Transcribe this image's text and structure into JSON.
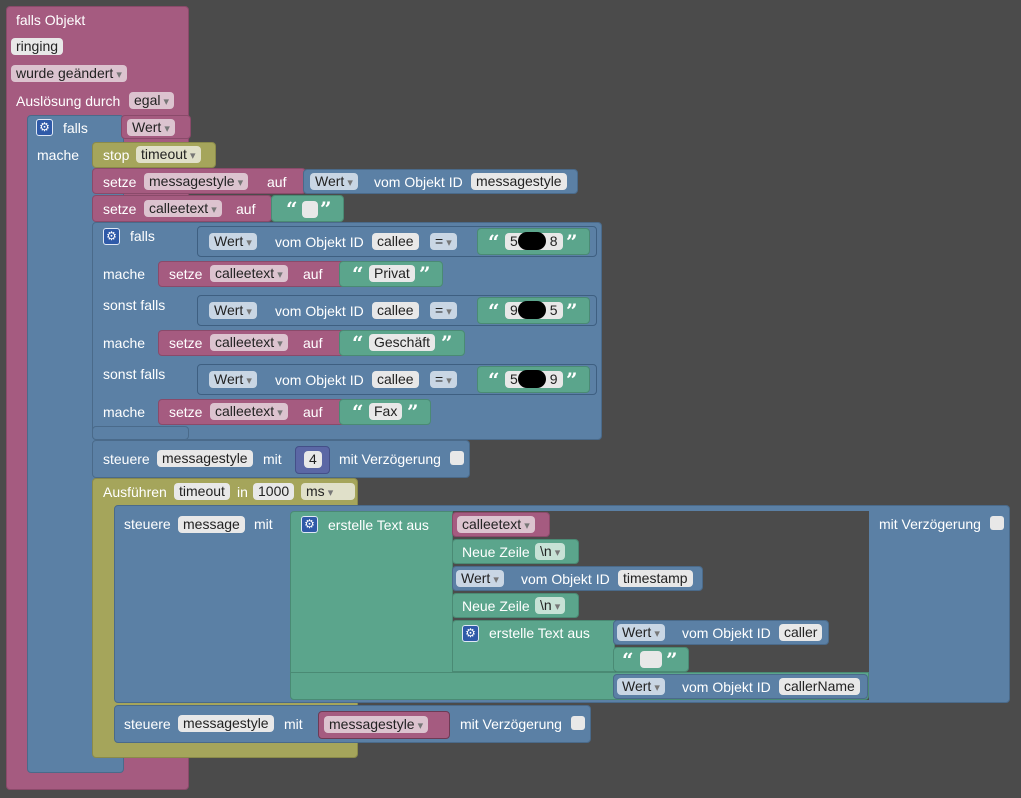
{
  "trigger": {
    "title": "falls Objekt",
    "object_id": "ringing",
    "condition": "wurde geändert",
    "trigger_label": "Auslösung durch",
    "trigger_value": "egal"
  },
  "if1": {
    "falls": "falls",
    "mache": "mache",
    "condition": "Wert"
  },
  "stop": {
    "label": "stop",
    "timer": "timeout"
  },
  "set1": {
    "setze": "setze",
    "var": "messagestyle",
    "auf": "auf",
    "prop": "Wert",
    "vom": "vom Objekt ID",
    "id": "messagestyle"
  },
  "set2": {
    "setze": "setze",
    "var": "calleetext",
    "auf": "auf"
  },
  "if2": {
    "falls": "falls",
    "mache": "mache",
    "sonst": "sonst falls",
    "conds": [
      {
        "prop": "Wert",
        "vom": "vom Objekt ID",
        "id": "callee",
        "op": "=",
        "val_a": "5",
        "val_b": "8"
      },
      {
        "prop": "Wert",
        "vom": "vom Objekt ID",
        "id": "callee",
        "op": "=",
        "val_a": "9",
        "val_b": "5"
      },
      {
        "prop": "Wert",
        "vom": "vom Objekt ID",
        "id": "callee",
        "op": "=",
        "val_a": "5",
        "val_b": "9"
      }
    ],
    "sets": [
      {
        "setze": "setze",
        "var": "calleetext",
        "auf": "auf",
        "val": "Privat"
      },
      {
        "setze": "setze",
        "var": "calleetext",
        "auf": "auf",
        "val": "Geschäft"
      },
      {
        "setze": "setze",
        "var": "calleetext",
        "auf": "auf",
        "val": "Fax"
      }
    ]
  },
  "ctl1": {
    "steuere": "steuere",
    "id": "messagestyle",
    "mit": "mit",
    "num": "4",
    "delay": "mit Verzögerung"
  },
  "timeout": {
    "label": "Ausführen",
    "timer": "timeout",
    "in": "in",
    "value": "1000",
    "unit": "ms"
  },
  "ctl2": {
    "steuere": "steuere",
    "id": "message",
    "mit": "mit",
    "delay": "mit Verzögerung",
    "join_label": "erstelle Text aus",
    "items": {
      "var1": "calleetext",
      "nl": "Neue Zeile",
      "nl_val": "\\n",
      "prop": "Wert",
      "vom": "vom Objekt ID",
      "ts": "timestamp",
      "caller": "caller",
      "callerName": "callerName"
    }
  },
  "ctl3": {
    "steuere": "steuere",
    "id": "messagestyle",
    "mit": "mit",
    "var": "messagestyle",
    "delay": "mit Verzögerung"
  },
  "quote_open": "“",
  "quote_close": "”",
  "icons": {
    "gear": "gear-icon",
    "check": "checkbox"
  }
}
